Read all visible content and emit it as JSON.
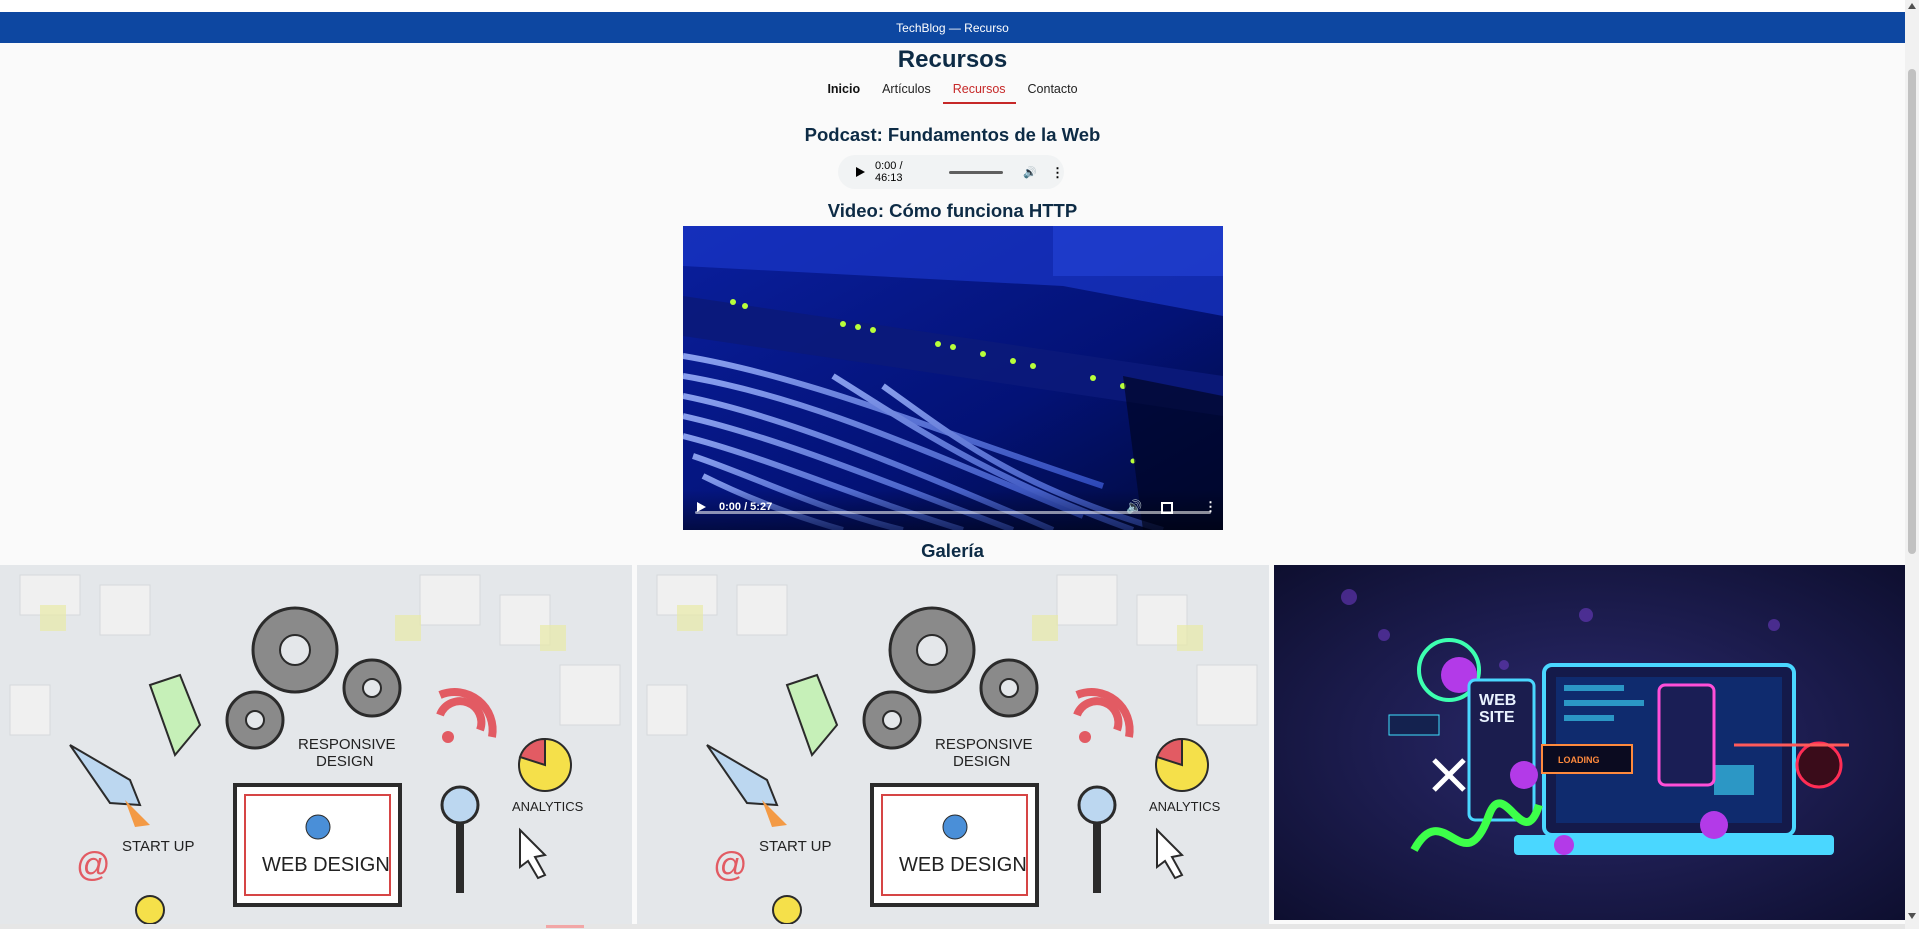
{
  "banner": {
    "title": "TechBlog — Recurso"
  },
  "page": {
    "title": "Recursos"
  },
  "nav": {
    "items": [
      {
        "label": "Inicio"
      },
      {
        "label": "Artículos"
      },
      {
        "label": "Recursos"
      },
      {
        "label": "Contacto"
      }
    ]
  },
  "podcast": {
    "title": "Podcast: Fundamentos de la Web",
    "time": "0:00 / 46:13"
  },
  "video": {
    "title": "Video: Cómo funciona HTTP",
    "time": "0:00 / 5:27"
  },
  "gallery": {
    "title": "Galería",
    "images": [
      {
        "words": [
          "RESPONSIVE",
          "DESIGN",
          "START UP",
          "ANALYTICS",
          "WEB DESIGN"
        ]
      },
      {
        "words": [
          "RESPONSIVE",
          "DESIGN",
          "START UP",
          "ANALYTICS",
          "WEB DESIGN"
        ]
      },
      {
        "words": [
          "WEB",
          "SITE",
          "LOADING"
        ]
      }
    ]
  },
  "colors": {
    "banner": "#0d47a1",
    "active_nav": "#c62828",
    "heading": "#0d2b45"
  }
}
